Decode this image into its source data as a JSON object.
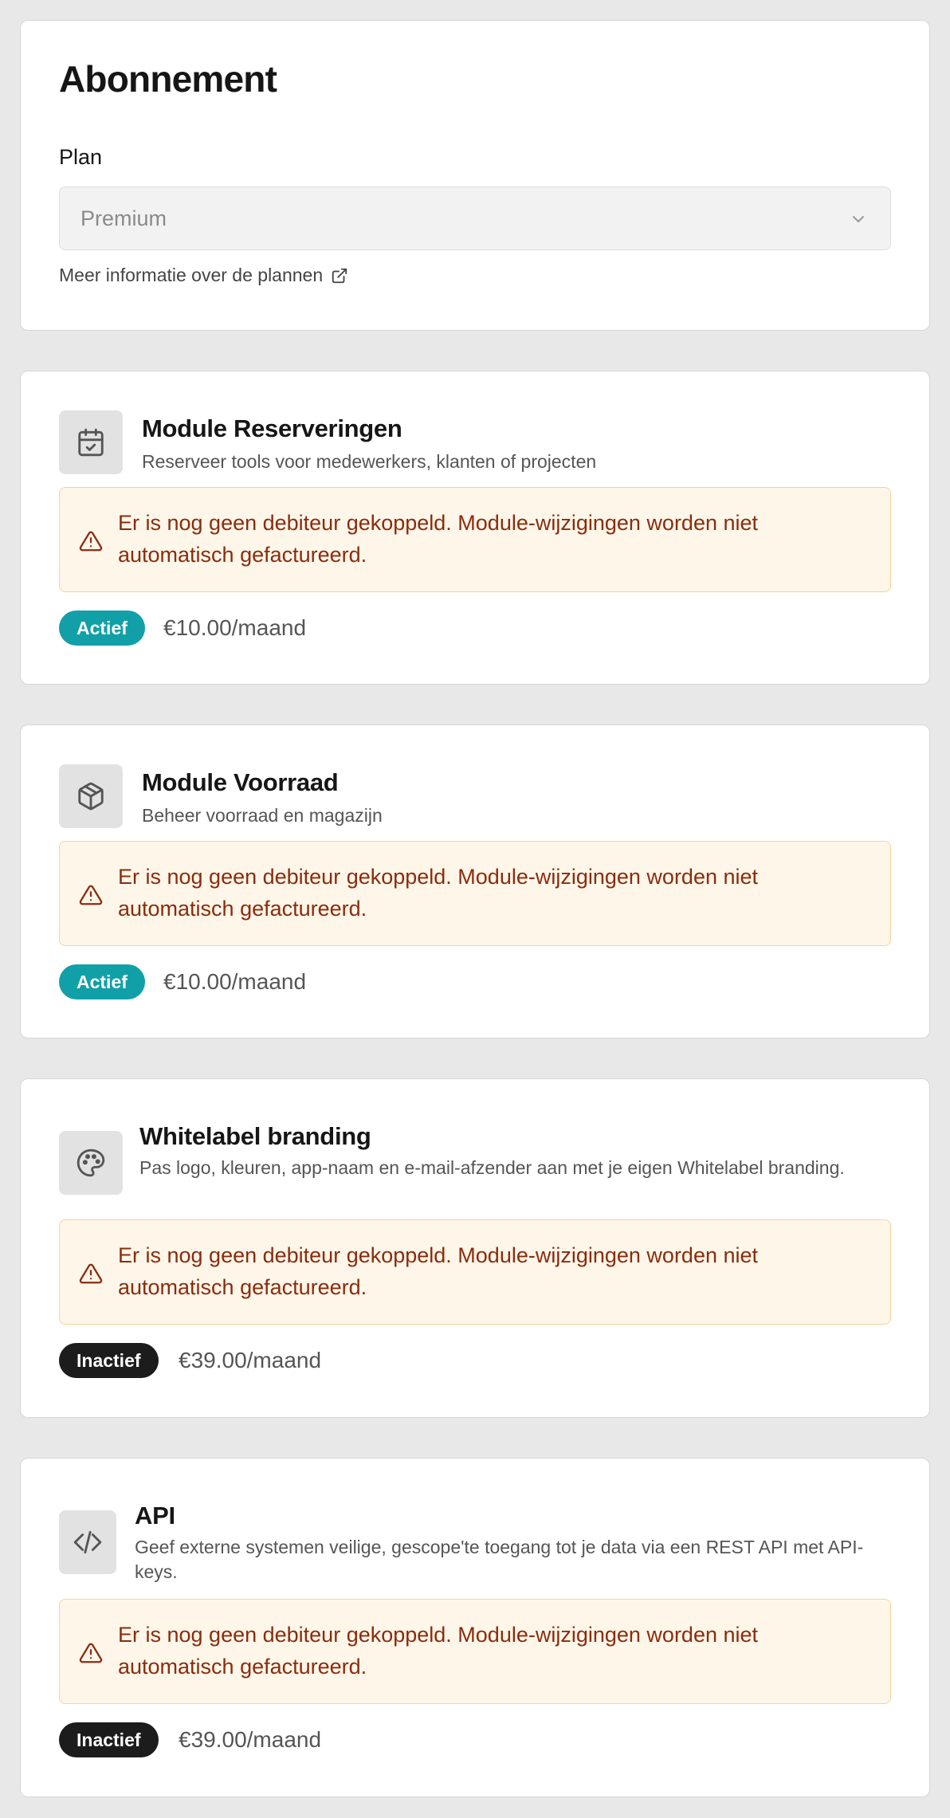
{
  "subscription": {
    "title": "Abonnement",
    "plan_label": "Plan",
    "plan_value": "Premium",
    "plan_link": "Meer informatie over de plannen"
  },
  "modules": [
    {
      "title": "Module Reserveringen",
      "description": "Reserveer tools voor medewerkers, klanten of projecten",
      "icon": "calendar-check-icon",
      "warning": "Er is nog geen debiteur gekoppeld. Module-wijzigingen worden niet automatisch gefactureerd.",
      "status": "Actief",
      "price": "€10.00/maand"
    },
    {
      "title": "Module Voorraad",
      "description": "Beheer voorraad en magazijn",
      "icon": "package-icon",
      "warning": "Er is nog geen debiteur gekoppeld. Module-wijzigingen worden niet automatisch gefactureerd.",
      "status": "Actief",
      "price": "€10.00/maand"
    },
    {
      "title": "Whitelabel branding",
      "description": "Pas logo, kleuren, app-naam en e-mail-afzender aan met je eigen Whitelabel branding.",
      "icon": "palette-icon",
      "warning": "Er is nog geen debiteur gekoppeld. Module-wijzigingen worden niet automatisch gefactureerd.",
      "status": "Inactief",
      "price": "€39.00/maand"
    },
    {
      "title": "API",
      "description": "Geef externe systemen veilige, gescope'te toegang tot je data via een REST API met API-keys.",
      "icon": "code-icon",
      "warning": "Er is nog geen debiteur gekoppeld. Module-wijzigingen worden niet automatisch gefactureerd.",
      "status": "Inactief",
      "price": "€39.00/maand"
    }
  ],
  "colors": {
    "active_badge": "#11a0a8",
    "inactive_badge": "#1c1c1c",
    "warning_bg": "#fef6e9",
    "warning_border": "#f4d49c",
    "warning_text": "#8a2c0d"
  }
}
